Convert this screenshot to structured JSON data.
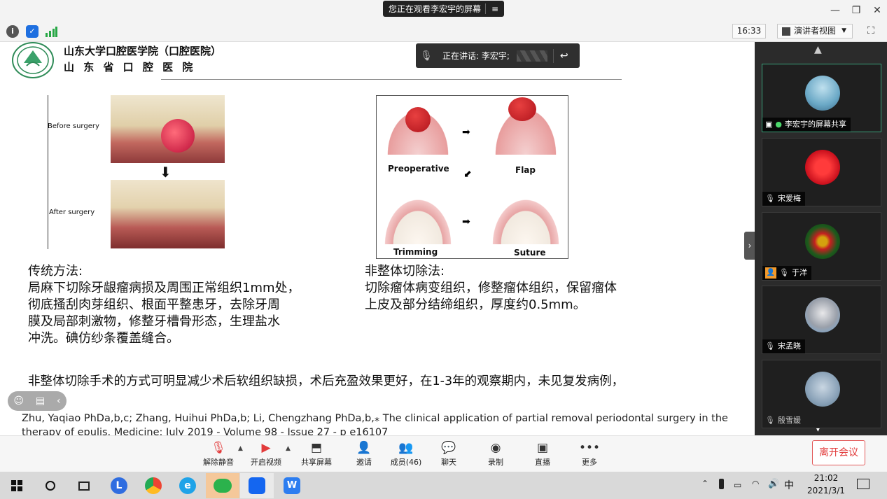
{
  "window": {
    "share_banner": "您正在观看李宏宇的屏幕",
    "menu_icon": "≡"
  },
  "toolbar": {
    "time": "16:33",
    "view_mode": "演讲者视图"
  },
  "speaking": {
    "label": "正在讲话: 李宏宇;"
  },
  "slide": {
    "institution_line1": "山东大学口腔医学院（口腔医院）",
    "institution_line2": "山 东 省 口 腔 医 院",
    "left_image_labels": {
      "before": "Before surgery",
      "after": "After surgery"
    },
    "right_image_labels": {
      "preoperative": "Preoperative",
      "flap": "Flap",
      "trimming": "Trimming",
      "suture": "Suture"
    },
    "left_heading": "传统方法:",
    "left_lines": [
      "局麻下切除牙龈瘤病损及周围正常组织1mm处，",
      "彻底搔刮肉芽组织、根面平整患牙，去除牙周",
      "膜及局部刺激物，修整牙槽骨形态，生理盐水",
      "冲洗。碘仿纱条覆盖缝合。"
    ],
    "right_heading": "非整体切除法:",
    "right_lines": [
      "切除瘤体病变组织，修整瘤体组织，保留瘤体",
      "上皮及部分结缔组织，厚度约0.5mm。"
    ],
    "conclusion": "非整体切除手术的方式可明显减少术后软组织缺损，术后充盈效果更好，在1-3年的观察期内，未见复发病例，",
    "citation_line1": "Zhu, Yaqiao PhDa,b,c; Zhang, Huihui PhDa,b; Li, Chengzhang PhDa,b,⁎  The clinical application of partial removal periodontal surgery in the",
    "citation_line2": "therapy of epulis. Medicine: July 2019 - Volume 98 - Issue 27 - p e16107"
  },
  "participants": [
    {
      "name": "李宏宇的屏幕共享",
      "active": true
    },
    {
      "name": "宋爱梅"
    },
    {
      "name": "于洋"
    },
    {
      "name": "宋孟晓"
    },
    {
      "name": "殷雪媛"
    }
  ],
  "meeting_bar": {
    "unmute": "解除静音",
    "start_video": "开启视频",
    "share_screen": "共享屏幕",
    "invite": "邀请",
    "members": "成员(46)",
    "chat": "聊天",
    "record": "录制",
    "live": "直播",
    "more": "更多",
    "leave": "离开会议"
  },
  "taskbar": {
    "time": "21:02",
    "date": "2021/3/1",
    "ime": "中"
  },
  "colors": {
    "leave_red": "#e23b3b",
    "active_border": "#3aa17a",
    "wechat_green": "#2bb24c",
    "panel_bg": "#2b2b2b"
  }
}
